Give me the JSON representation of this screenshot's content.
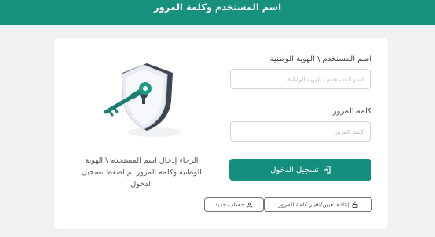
{
  "header": {
    "title": "اسم المستخدم وكلمة المرور"
  },
  "form": {
    "username_label": "اسم المستخدم \\ الهوية الوطنية",
    "username_placeholder": "اسم المستخدم \\ الهوية الوطنية",
    "username_value": "",
    "password_label": "كلمة المرور",
    "password_placeholder": "كلمة المرور",
    "password_value": "",
    "login_label": "تسجيل الدخول",
    "reset_label": "إعادة تعيين/تغيير كلمة المرور",
    "new_account_label": "حساب جديد"
  },
  "instruction": "الرجاء إدخال اسم المستخدم \\ الهوية الوطنية وكلمة المرور ثم اضغط تسجيل الدخول",
  "icons": {
    "login": "login-arrow-icon",
    "reset": "lock-icon",
    "new_account": "user-icon",
    "illustration": "shield-key-illustration"
  },
  "colors": {
    "primary": "#17907e",
    "background": "#f1f2f3",
    "card": "#ffffff"
  }
}
